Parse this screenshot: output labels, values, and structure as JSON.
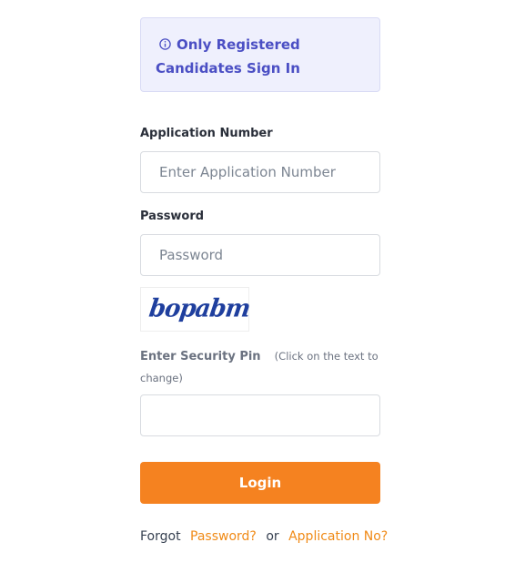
{
  "alert": {
    "text_line1": "Only Registered",
    "text_line2": "Candidates Sign In",
    "icon": "info-icon"
  },
  "application_number": {
    "label": "Application Number",
    "placeholder": "Enter Application Number",
    "value": ""
  },
  "password": {
    "label": "Password",
    "placeholder": "Password",
    "value": ""
  },
  "captcha": {
    "text": "bopabm"
  },
  "security_pin": {
    "label": "Enter Security Pin",
    "hint": "(Click on the text to change)",
    "value": ""
  },
  "login_button": {
    "label": "Login"
  },
  "forgot": {
    "prefix": "Forgot",
    "password_link": "Password?",
    "or": "or",
    "application_link": "Application No?"
  },
  "colors": {
    "accent": "#f58220",
    "alert_text": "#4b4fc4",
    "alert_bg": "#eff0fd",
    "link": "#f08a16"
  }
}
